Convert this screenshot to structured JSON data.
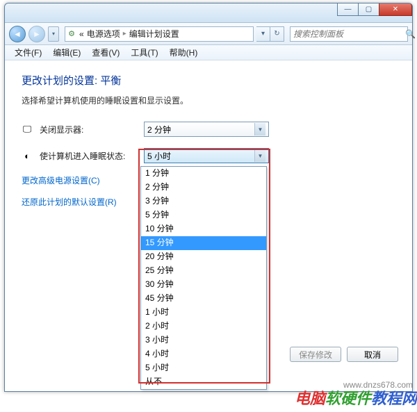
{
  "breadcrumb": {
    "prefix": "«",
    "item1": "电源选项",
    "item2": "编辑计划设置"
  },
  "search": {
    "placeholder": "搜索控制面板"
  },
  "menu": {
    "file": "文件(F)",
    "edit": "编辑(E)",
    "view": "查看(V)",
    "tools": "工具(T)",
    "help": "帮助(H)"
  },
  "page": {
    "heading": "更改计划的设置: 平衡",
    "subtext": "选择希望计算机使用的睡眠设置和显示设置。",
    "row1_label": "关闭显示器:",
    "row1_value": "2 分钟",
    "row2_label": "使计算机进入睡眠状态:",
    "row2_value": "5 小时",
    "adv_link": "更改高级电源设置(C)",
    "restore_link": "还原此计划的默认设置(R)",
    "save_btn": "保存修改",
    "cancel_btn": "取消"
  },
  "options": [
    "1 分钟",
    "2 分钟",
    "3 分钟",
    "5 分钟",
    "10 分钟",
    "15 分钟",
    "20 分钟",
    "25 分钟",
    "30 分钟",
    "45 分钟",
    "1 小时",
    "2 小时",
    "3 小时",
    "4 小时",
    "5 小时",
    "从不"
  ],
  "selected_option": "15 分钟",
  "watermark": {
    "t1": "电脑",
    "t2": "软硬件",
    "t3": "教程网",
    "url": "www.dnzs678.com"
  }
}
